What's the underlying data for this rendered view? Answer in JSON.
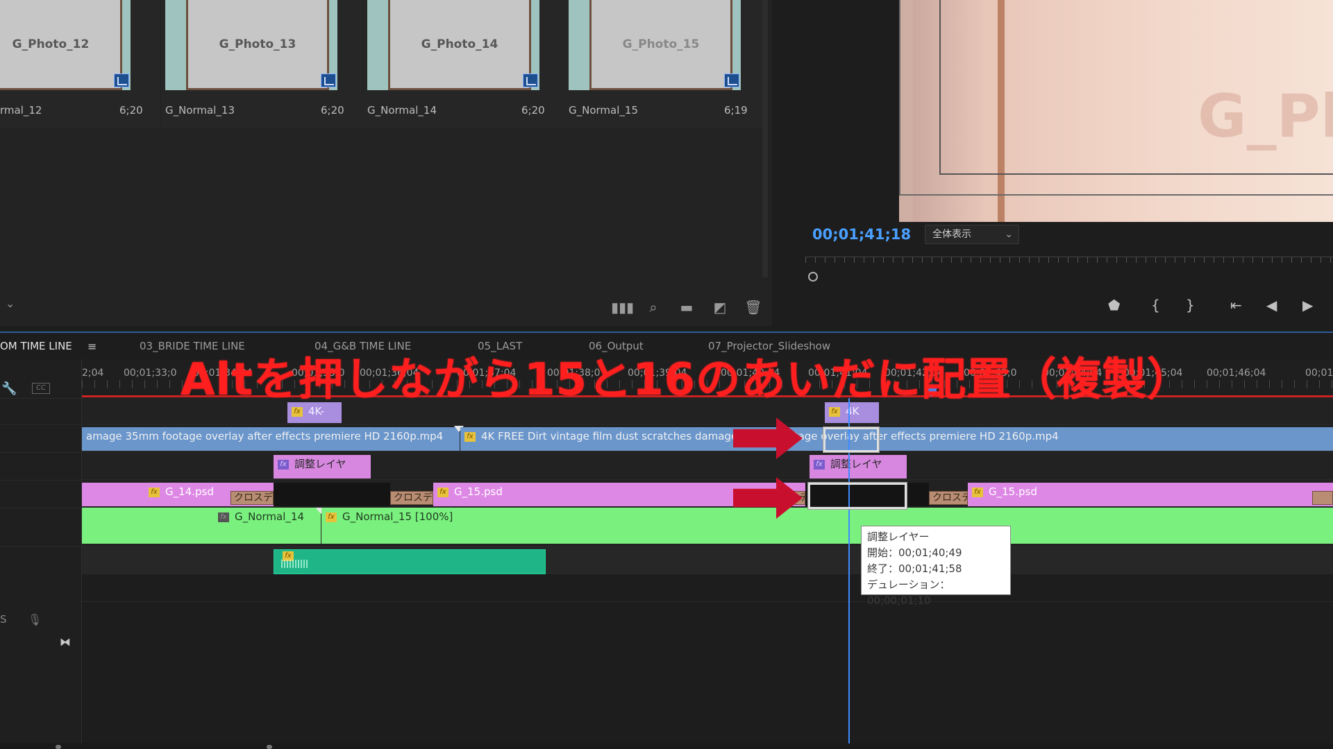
{
  "bin": {
    "items": [
      {
        "photo": "G_Photo_12",
        "name": "rmal_12",
        "duration": "6;20"
      },
      {
        "photo": "G_Photo_13",
        "name": "G_Normal_13",
        "duration": "6;20"
      },
      {
        "photo": "G_Photo_14",
        "name": "G_Normal_14",
        "duration": "6;20"
      },
      {
        "photo": "G_Photo_15",
        "name": "G_Normal_15",
        "duration": "6;19"
      }
    ],
    "toolbar": {
      "chevron": "⌄"
    }
  },
  "monitor": {
    "frame_text": "G_Pho",
    "timecode": "00;01;41;18",
    "fit_select": "全体表示"
  },
  "timeline": {
    "tabs": [
      {
        "label": "OM TIME LINE",
        "active": true
      },
      {
        "label": "03_BRIDE TIME LINE",
        "active": false
      },
      {
        "label": "04_G&B TIME LINE",
        "active": false
      },
      {
        "label": "05_LAST",
        "active": false
      },
      {
        "label": "06_Output",
        "active": false
      },
      {
        "label": "07_Projector_Slideshow",
        "active": false
      }
    ],
    "menu_icon": "≡",
    "cc_label": "CC",
    "s_label": "S",
    "ruler_labels": [
      "2;04",
      "00;01;33;0",
      "00;01;34;04",
      "00;01;35;0",
      "00;01;36;04",
      "00;01;37;04",
      "00;01;38;0",
      "00;01;39;04",
      "00;01;40;04",
      "00;01;41;04",
      "00;01;42;04",
      "00;01;43;0",
      "00;01;44;04",
      "00;01;45;04",
      "00;01;46;04",
      "00;01"
    ],
    "clips": {
      "v4_a": "4K-",
      "v4_b": "4K",
      "v3_a": "amage 35mm footage overlay after effects premiere HD 2160p.mp4",
      "v3_b": "4K FREE Dirt vintage film dust scratches damage 35mm footage overlay after effects premiere HD 2160p.mp4",
      "v2_a": "調整レイヤ",
      "v2_b": "調整レイヤ",
      "v1_a": "G_14.psd",
      "v1_b": "G_15.psd",
      "v1_c": "G_15.psd",
      "trans": "クロスデ",
      "bg_a": "G_Normal_14",
      "bg_b": "G_Normal_15 [100%]"
    },
    "tooltip": {
      "title": "調整レイヤー",
      "start": "開始：00;01;40;49",
      "end": "終了：00;01;41;58",
      "duration": "デュレーション：00;00;01;10"
    }
  },
  "annotation": {
    "caption": "Altを押しながら15と16のあいだに配置（複製）",
    "color": "#ff1f1f"
  }
}
